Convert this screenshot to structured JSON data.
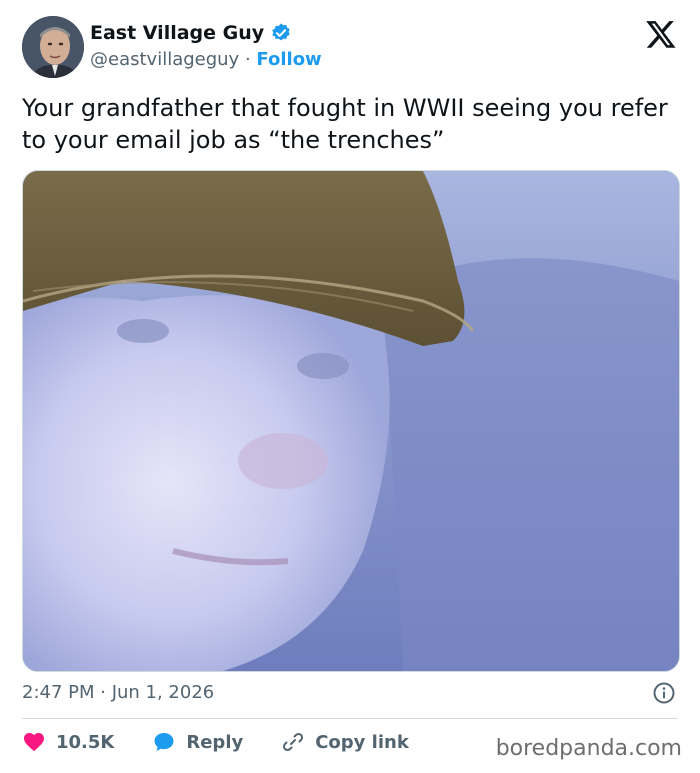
{
  "author": {
    "display_name": "East Village Guy",
    "handle": "@eastvillageguy",
    "separator": "·",
    "follow_label": "Follow",
    "verified": true
  },
  "tweet": {
    "text": "Your grandfather that fought in WWII seeing you refer to your email job as “the trenches”",
    "timestamp": "2:47 PM · Jun 1, 2026"
  },
  "actions": {
    "like_count": "10.5K",
    "reply_label": "Reply",
    "copy_link_label": "Copy link"
  },
  "watermark": "boredpanda.com",
  "colors": {
    "accent": "#1d9bf0",
    "like": "#f91880",
    "muted": "#536471",
    "text": "#0f1419"
  },
  "icons": {
    "verified": "verified-badge-icon",
    "platform": "x-logo-icon",
    "info": "info-icon",
    "like": "heart-icon",
    "reply": "speech-bubble-icon",
    "copy_link": "link-icon"
  }
}
